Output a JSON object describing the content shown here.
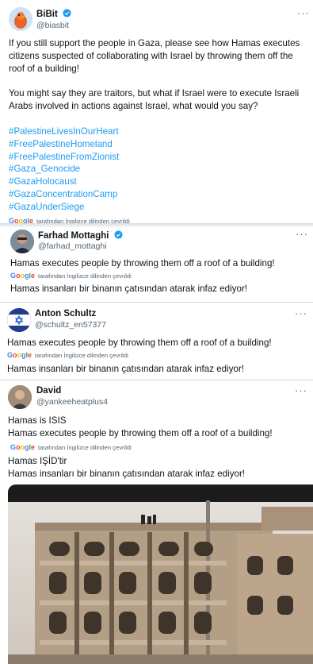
{
  "post1": {
    "name": "BiBit",
    "handle": "@biasbit",
    "more": "···",
    "body": [
      "If you still support the people in Gaza, please see how Hamas executes",
      "citizens suspected of collaborating with Israel by throwing them off the",
      "roof of a building!",
      "",
      "You might say they are traitors, but what if Israel were to execute Israeli",
      "Arabs involved in actions against Israel, what would you say?"
    ],
    "hashtags": [
      "#PalestineLivesInOurHeart",
      "#FreePalestineHomeland",
      "#FreePalestineFromZionist",
      "#Gaza_Genocide",
      "#GazaHolocaust",
      "#GazaConcentrationCamp",
      "#GazaUnderSiege"
    ],
    "translated_by": "tarafından İngilizce dilinden çevrildi"
  },
  "post2": {
    "name": "Farhad Mottaghi",
    "handle": "@farhad_mottaghi",
    "more": "···",
    "text": "Hamas executes people by throwing them off a roof of a building!",
    "translated_by": "tarafından İngilizce dilinden çevrildi",
    "translation": "Hamas insanları bir binanın çatısından atarak infaz ediyor!"
  },
  "post3": {
    "name": "Anton Schultz",
    "handle": "@schultz_en57377",
    "more": "···",
    "text": "Hamas executes people by throwing them off a roof of a building!",
    "translated_by": "tarafından İngilizce dilinden çevrildi",
    "translation": "Hamas insanları bir binanın çatısından atarak infaz ediyor!"
  },
  "post4": {
    "name": "David",
    "handle": "@yankeeheatplus4",
    "more": "···",
    "lines": [
      "Hamas is ISIS",
      "Hamas executes people by throwing them off a roof of a building!"
    ],
    "translated_by": "tarafından İngilizce dilinden çevrildi",
    "translation_lines": [
      "Hamas IŞİD'tir",
      "Hamas insanları bir binanın çatısından atarak infaz ediyor!"
    ]
  },
  "google": {
    "g1": "G",
    "g2": "o",
    "g3": "o",
    "g4": "g",
    "g5": "l",
    "g6": "e"
  },
  "colors": {
    "link": "#1d9bf0",
    "verified": "#1d9bf0",
    "secondary": "#536471"
  }
}
